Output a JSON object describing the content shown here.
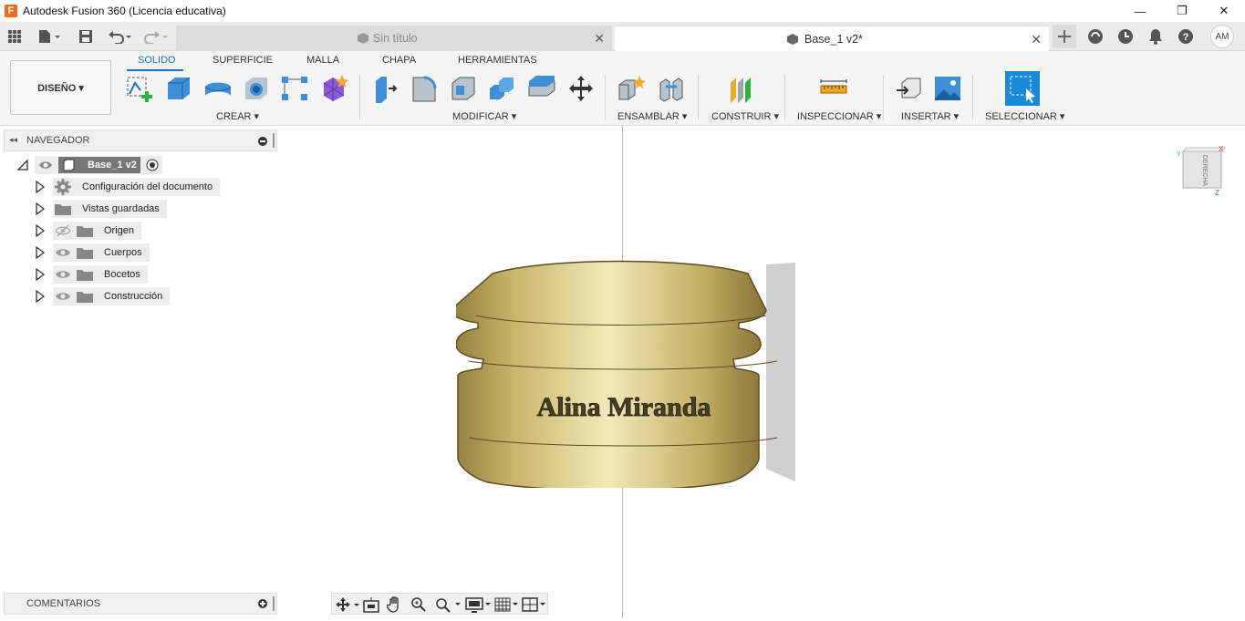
{
  "window": {
    "title": "Autodesk Fusion 360 (Licencia educativa)",
    "app_icon_letter": "F",
    "min_glyph": "—",
    "max_glyph": "❐",
    "close_glyph": "✕"
  },
  "tabs": [
    {
      "label": "Sin título",
      "active": false,
      "close": "✕"
    },
    {
      "label": "Base_1 v2*",
      "active": true,
      "close": "✕"
    }
  ],
  "user": {
    "initials": "AM"
  },
  "workspace": {
    "label": "DISEÑO ▾"
  },
  "ribbon_tabs": [
    "SOLIDO",
    "SUPERFICIE",
    "MALLA",
    "CHAPA",
    "HERRAMIENTAS"
  ],
  "groups": {
    "crear": "CREAR ▾",
    "modificar": "MODIFICAR ▾",
    "ensamblar": "ENSAMBLAR ▾",
    "construir": "CONSTRUIR ▾",
    "inspeccionar": "INSPECCIONAR ▾",
    "insertar": "INSERTAR ▾",
    "seleccionar": "SELECCIONAR ▾"
  },
  "browser": {
    "title": "NAVEGADOR",
    "collapse_glyph": "◂◂",
    "root": "Base_1 v2",
    "items": [
      {
        "label": "Configuración del documento"
      },
      {
        "label": "Vistas guardadas"
      },
      {
        "label": "Origen"
      },
      {
        "label": "Cuerpos"
      },
      {
        "label": "Bocetos"
      },
      {
        "label": "Construcción"
      }
    ]
  },
  "comments": {
    "title": "COMENTARIOS"
  },
  "viewcube": {
    "face": "DERECHA",
    "axis_x": "X",
    "axis_y": "Y",
    "axis_z": "Z"
  },
  "model": {
    "engraving": "Alina Miranda"
  },
  "colors": {
    "accent": "#1a73c7",
    "brass": "#c9b46a",
    "create_green": "#2fb33a"
  }
}
